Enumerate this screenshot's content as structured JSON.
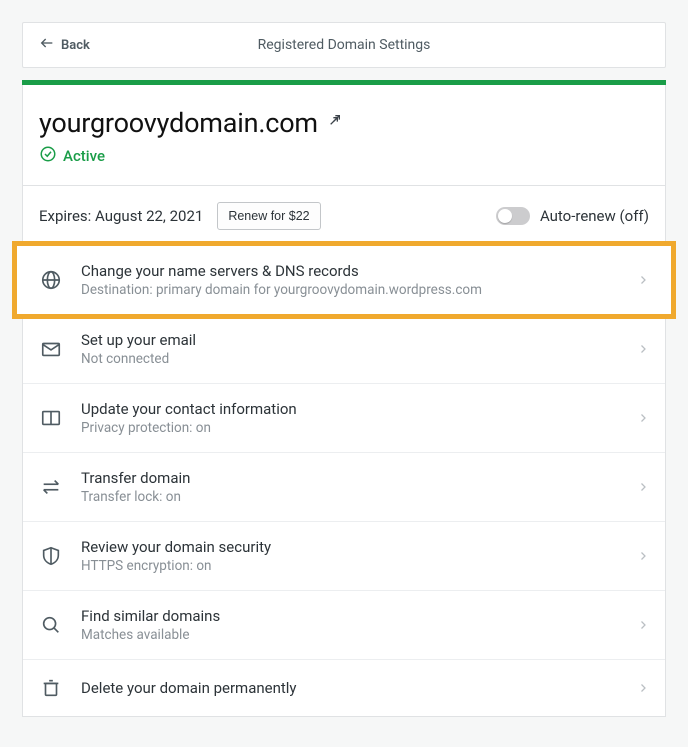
{
  "header": {
    "back_label": "Back",
    "title": "Registered Domain Settings"
  },
  "domain": {
    "name": "yourgroovydomain.com",
    "status": "Active"
  },
  "expiry": {
    "label": "Expires: August 22, 2021",
    "renew_label": "Renew for $22",
    "autorenew_label": "Auto-renew (off)",
    "autorenew_on": false
  },
  "options": [
    {
      "icon": "globe-icon",
      "title": "Change your name servers & DNS records",
      "sub": "Destination: primary domain for yourgroovydomain.wordpress.com",
      "highlighted": true
    },
    {
      "icon": "mail-icon",
      "title": "Set up your email",
      "sub": "Not connected"
    },
    {
      "icon": "card-icon",
      "title": "Update your contact information",
      "sub": "Privacy protection: on"
    },
    {
      "icon": "transfer-icon",
      "title": "Transfer domain",
      "sub": "Transfer lock: on"
    },
    {
      "icon": "shield-icon",
      "title": "Review your domain security",
      "sub": "HTTPS encryption: on"
    },
    {
      "icon": "search-icon",
      "title": "Find similar domains",
      "sub": "Matches available"
    },
    {
      "icon": "trash-icon",
      "title": "Delete your domain permanently",
      "sub": ""
    }
  ]
}
